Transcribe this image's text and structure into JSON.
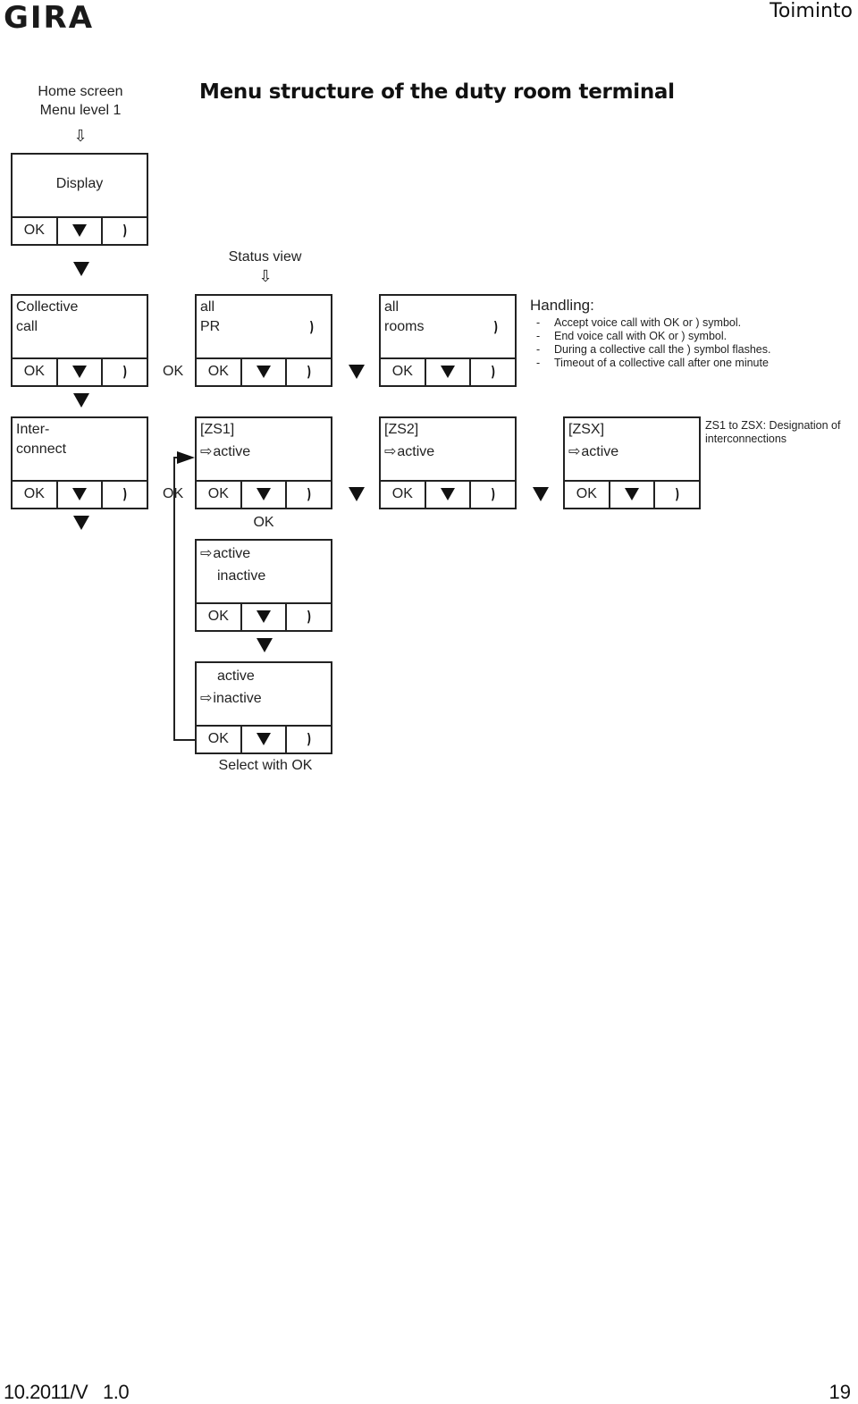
{
  "header": {
    "logo": "GIRA",
    "section": "Toiminto"
  },
  "home_label": {
    "line1": "Home screen",
    "line2": "Menu level 1"
  },
  "page_title": "Menu structure of the duty room terminal",
  "status_view_label": "Status view",
  "icons": {
    "down_hollow_arrow": "⇩",
    "right_hollow_arrow": "⇨",
    "phone": ")"
  },
  "buttons": {
    "ok": "OK"
  },
  "terminals": {
    "display": {
      "line1": "Display"
    },
    "collective_call": {
      "line1": "Collective",
      "line2": "call"
    },
    "all_pr": {
      "line1": "all",
      "line2": "PR"
    },
    "all_rooms": {
      "line1": "all",
      "line2": "rooms"
    },
    "interconnect": {
      "line1": "Inter-",
      "line2": "connect"
    },
    "zs1": {
      "line1": "[ZS1]",
      "line2": "active"
    },
    "zs2": {
      "line1": "[ZS2]",
      "line2": "active"
    },
    "zsx": {
      "line1": "[ZSX]",
      "line2": "active"
    },
    "select_active": {
      "line1": "active",
      "line2": "inactive"
    },
    "select_inactive": {
      "line1": "active",
      "line2": "inactive"
    }
  },
  "flow_labels": {
    "ok_between_collective_pr": "OK",
    "ok_between_interconnect_zs1": "OK",
    "ok_below_zs1": "OK",
    "select_with_ok": "Select with OK"
  },
  "handling": {
    "title": "Handling:",
    "items": [
      "Accept voice call with OK or ) symbol.",
      "End voice call with OK or ) symbol.",
      "During a collective call the ) symbol flashes.",
      "Timeout of a collective call after one minute"
    ]
  },
  "note": "ZS1 to ZSX: Designation of interconnections",
  "footer": {
    "version": "10.2011/V   1.0",
    "page_number": "19"
  }
}
